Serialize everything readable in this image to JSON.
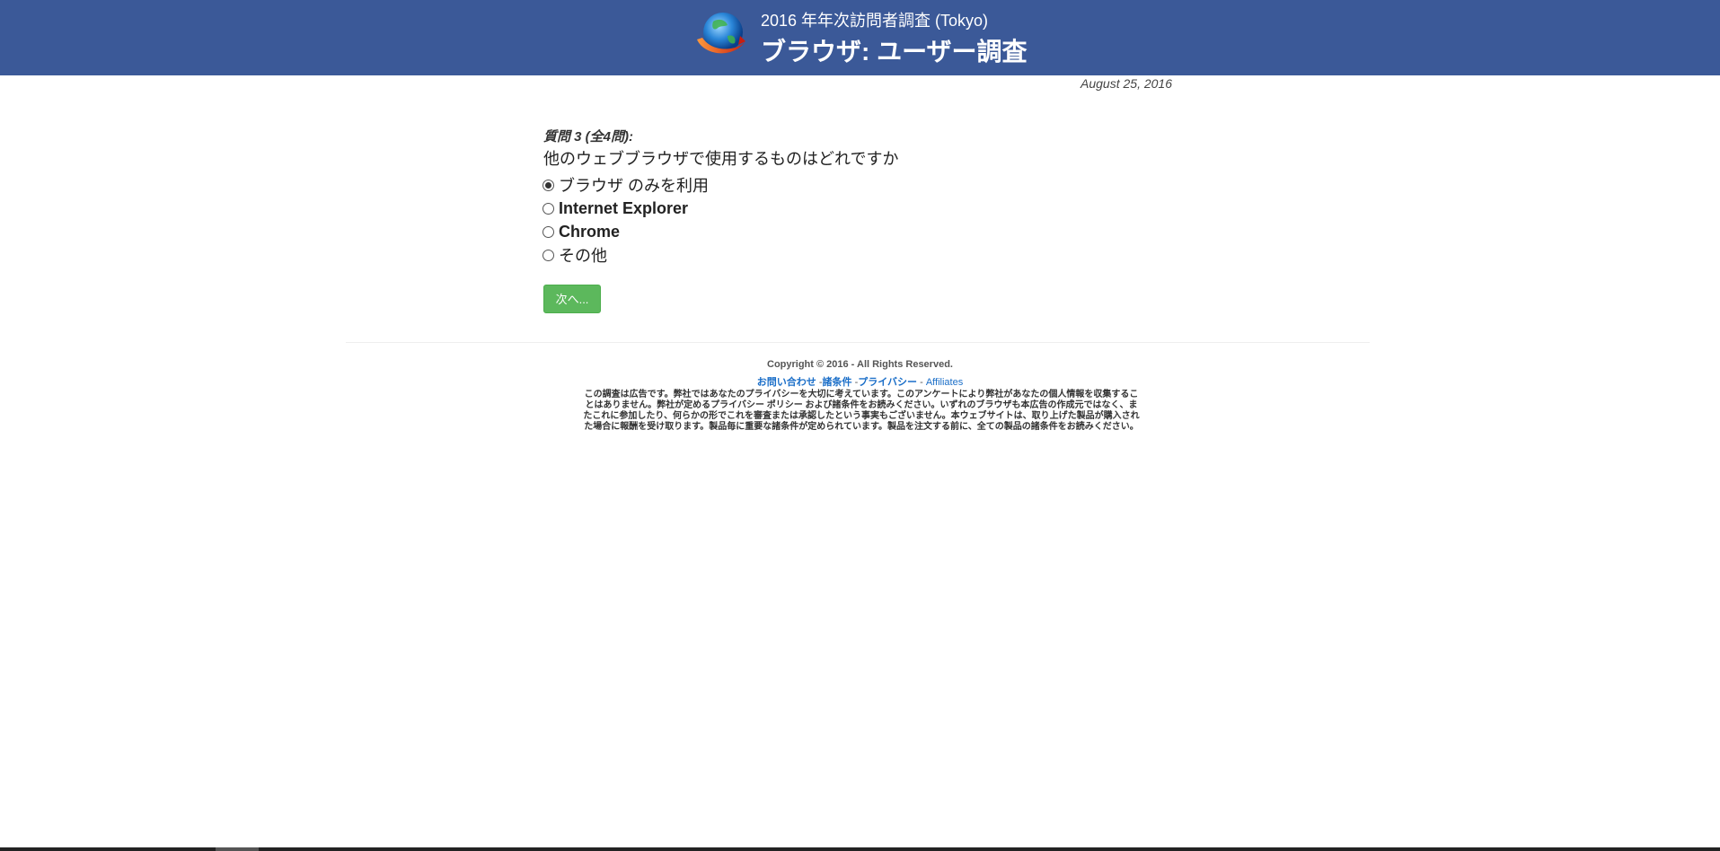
{
  "header": {
    "subtitle": "2016 年年次訪問者調査 (Tokyo)",
    "title": "ブラウザ: ユーザー調査",
    "logo_icon": "globe-browser-icon",
    "background_color": "#3b5998"
  },
  "date": "August 25, 2016",
  "question": {
    "number_label": "質問 3 (全4問):",
    "text": "他のウェブブラウザで使用するものはどれですか",
    "options": [
      {
        "label": "ブラウザ のみを利用",
        "selected": true
      },
      {
        "label": "Internet Explorer",
        "selected": false
      },
      {
        "label": "Chrome",
        "selected": false
      },
      {
        "label": "その他",
        "selected": false
      }
    ]
  },
  "next_button": {
    "label": "次へ...",
    "color": "#5cb85c"
  },
  "footer": {
    "copyright": "Copyright © 2016 - All Rights Reserved.",
    "links": [
      {
        "label": "お問い合わせ"
      },
      {
        "label": "諸条件"
      },
      {
        "label": "プライバシー"
      },
      {
        "label": "Affiliates"
      }
    ],
    "separator": "-",
    "disclaimer": "この調査は広告です。弊社ではあなたのプライバシーを大切に考えています。このアンケートにより弊社があなたの個人情報を収集することはありません。弊社が定めるプライバシー ポリシー および諸条件をお読みください。いずれのブラウザも本広告の作成元ではなく、またこれに参加したり、何らかの形でこれを審査または承認したという事実もございません。本ウェブサイトは、取り上げた製品が購入された場合に報酬を受け取ります。製品毎に重要な諸条件が定められています。製品を注文する前に、全ての製品の諸条件をお読みください。",
    "link_color": "#1a6ec8"
  }
}
